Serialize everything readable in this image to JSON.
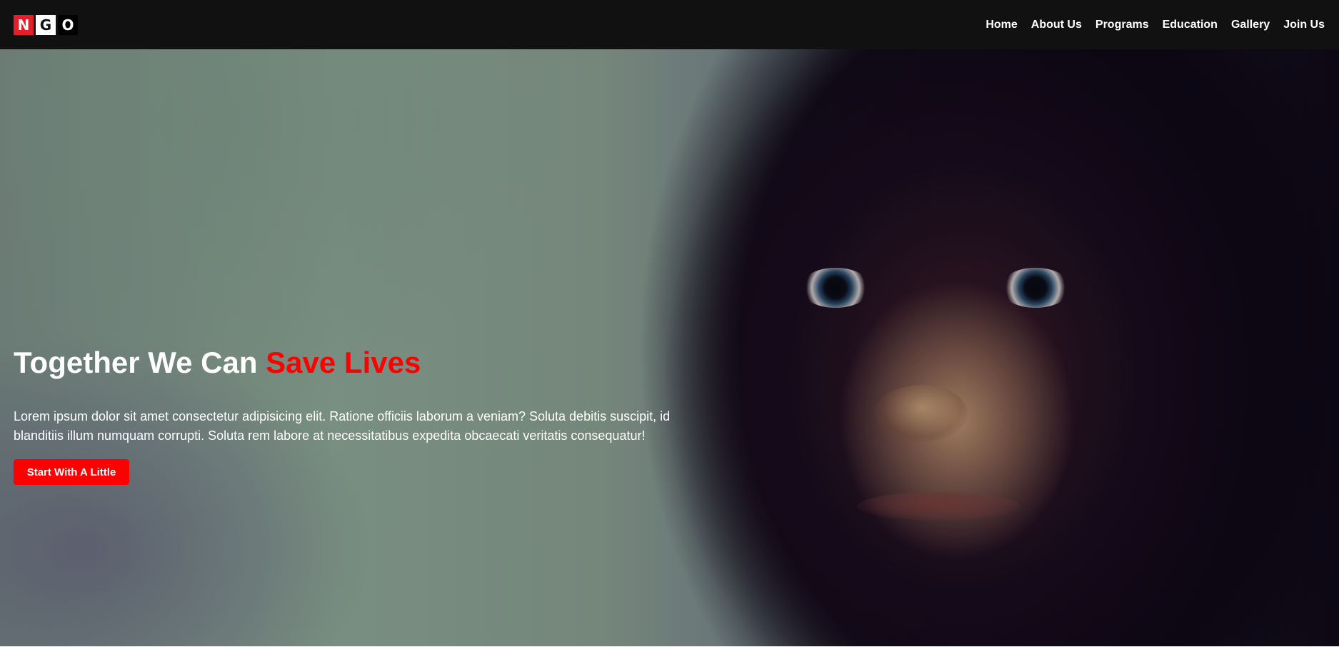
{
  "logo": {
    "letters": [
      "N",
      "G",
      "O"
    ]
  },
  "nav": {
    "items": [
      {
        "label": "Home"
      },
      {
        "label": "About Us"
      },
      {
        "label": "Programs"
      },
      {
        "label": "Education"
      },
      {
        "label": "Gallery"
      },
      {
        "label": "Join Us"
      }
    ]
  },
  "hero": {
    "title_main": "Together We Can ",
    "title_accent": "Save Lives",
    "description": "Lorem ipsum dolor sit amet consectetur adipisicing elit. Ratione officiis laborum a veniam? Soluta debitis suscipit, id blanditiis illum numquam corrupti. Soluta rem labore at necessitatibus expedita obcaecati veritatis consequatur!",
    "cta_label": "Start With A Little"
  },
  "colors": {
    "navbar_bg": "#111111",
    "accent": "#ff0000",
    "logo_red": "#e3202a",
    "text": "#ffffff"
  }
}
